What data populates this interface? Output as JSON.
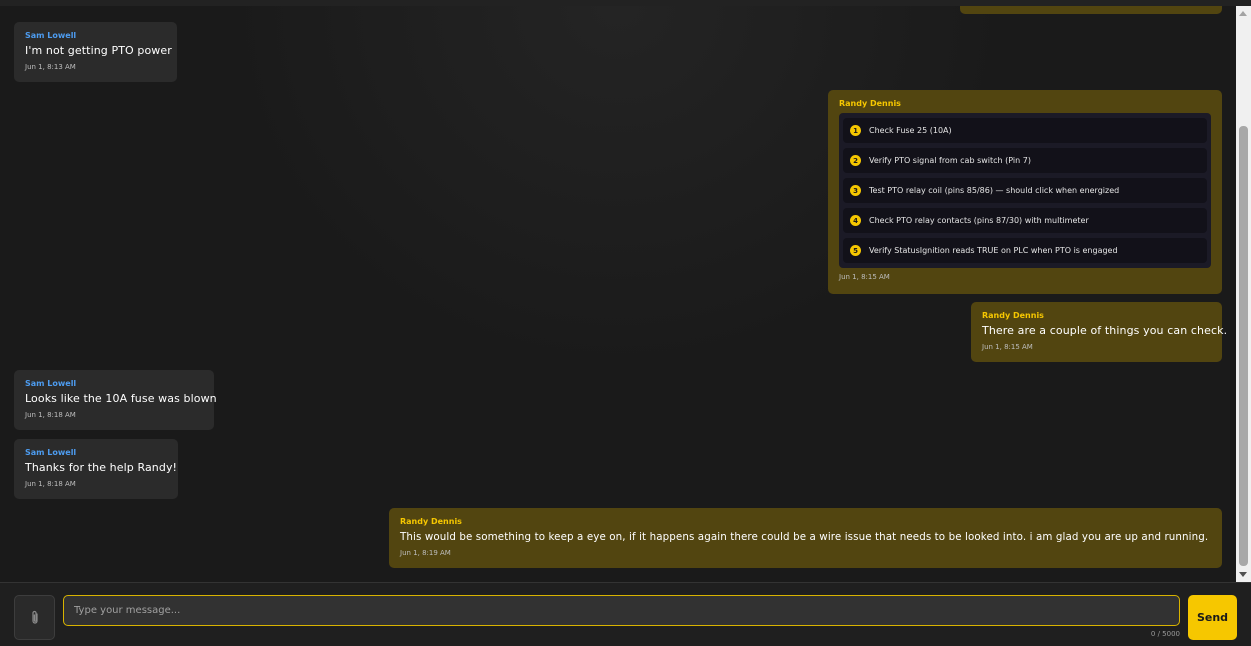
{
  "messages": [
    {
      "sender": "Sam Lowell",
      "text": "I'm not getting PTO power",
      "time": "Jun 1, 8:13 AM"
    },
    {
      "sender": "Randy Dennis",
      "checklist": [
        "Check Fuse 25 (10A)",
        "Verify PTO signal from cab switch (Pin 7)",
        "Test PTO relay coil (pins 85/86) — should click when energized",
        "Check PTO relay contacts (pins 87/30) with multimeter",
        "Verify StatusIgnition reads TRUE on PLC when PTO is engaged"
      ],
      "time": "Jun 1, 8:15 AM"
    },
    {
      "sender": "Randy Dennis",
      "text": "There are a couple of things you can check.",
      "time": "Jun 1, 8:15 AM"
    },
    {
      "sender": "Sam Lowell",
      "text": "Looks like the 10A fuse was blown",
      "time": "Jun 1, 8:18 AM"
    },
    {
      "sender": "Sam Lowell",
      "text": "Thanks for the help Randy!",
      "time": "Jun 1, 8:18 AM"
    },
    {
      "sender": "Randy Dennis",
      "text": "This would be something to keep a eye on, if it happens again there could be a wire issue that needs to be looked into. i am glad you are up and running.",
      "time": "Jun 1, 8:19 AM"
    }
  ],
  "composer": {
    "placeholder": "Type your message...",
    "char_count": "0 / 5000",
    "send_label": "Send",
    "attach_icon": "paperclip-icon"
  },
  "colors": {
    "accent": "#f6c700",
    "outgoing_bubble": "#524510",
    "incoming_bubble": "#2b2b2b",
    "incoming_name": "#4d9cf0"
  }
}
